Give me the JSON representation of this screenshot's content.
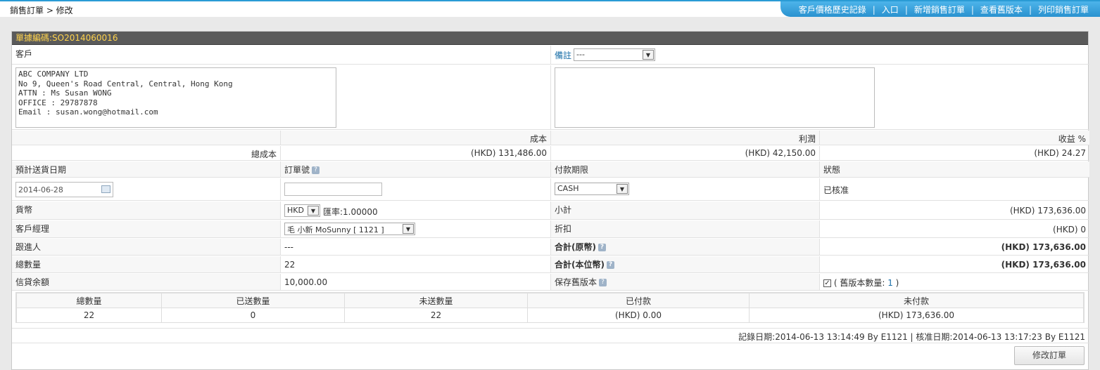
{
  "breadcrumb": "銷售訂單 > 修改",
  "top_links": [
    "客戶價格歷史記錄",
    "入口",
    "新增銷售訂單",
    "查看舊版本",
    "列印銷售訂單"
  ],
  "order": {
    "title": "單據編碼:SO2014060016",
    "customer_label": "客戶",
    "remark_label": "備註",
    "remark_select": "---",
    "customer_address": "ABC COMPANY LTD\nNo 9, Queen's Road Central, Central, Hong Kong\nATTN : Ms Susan WONG\nOFFICE : 29787878\nEmail : susan.wong@hotmail.com",
    "remark_text": "",
    "headers": {
      "cost": "成本",
      "profit": "利潤",
      "margin": "收益 %"
    },
    "total_cost_label": "總成本",
    "total_cost": "(HKD) 131,486.00",
    "profit": "(HKD) 42,150.00",
    "margin": "(HKD) 24.27",
    "delivery_label": "預計送貨日期",
    "delivery_date": "2014-06-28",
    "order_no_label": "訂單號",
    "order_no": "",
    "payment_term_label": "付款期限",
    "payment_term": "CASH",
    "status_label": "狀態",
    "status": "已核准",
    "currency_label": "貨幣",
    "currency": "HKD",
    "exchange_rate": "匯率:1.00000",
    "subtotal_label": "小計",
    "subtotal": "(HKD) 173,636.00",
    "manager_label": "客戶經理",
    "manager": "毛 小新 MoSunny [ 1121 ]",
    "discount_label": "折扣",
    "discount": "(HKD) 0",
    "follower_label": "跟進人",
    "follower": "---",
    "total_orig_label": "合計(原幣)",
    "total_orig": "(HKD) 173,636.00",
    "total_qty_label": "總數量",
    "total_qty": "22",
    "total_base_label": "合計(本位幣)",
    "total_base": "(HKD) 173,636.00",
    "credit_label": "信貸余額",
    "credit": "10,000.00",
    "keep_version_label": "保存舊版本",
    "keep_version_text": "( 舊版本數量: ",
    "version_count": "1",
    "keep_version_close": " )"
  },
  "summary": {
    "headers": [
      "總數量",
      "已送數量",
      "未送數量",
      "已付款",
      "未付款"
    ],
    "values": [
      "22",
      "0",
      "22",
      "(HKD) 0.00",
      "(HKD) 173,636.00"
    ]
  },
  "record_info": "記錄日期:2014-06-13 13:14:49 By E1121 | 核准日期:2014-06-13 13:17:23 By E1121",
  "edit_button": "修改訂單"
}
